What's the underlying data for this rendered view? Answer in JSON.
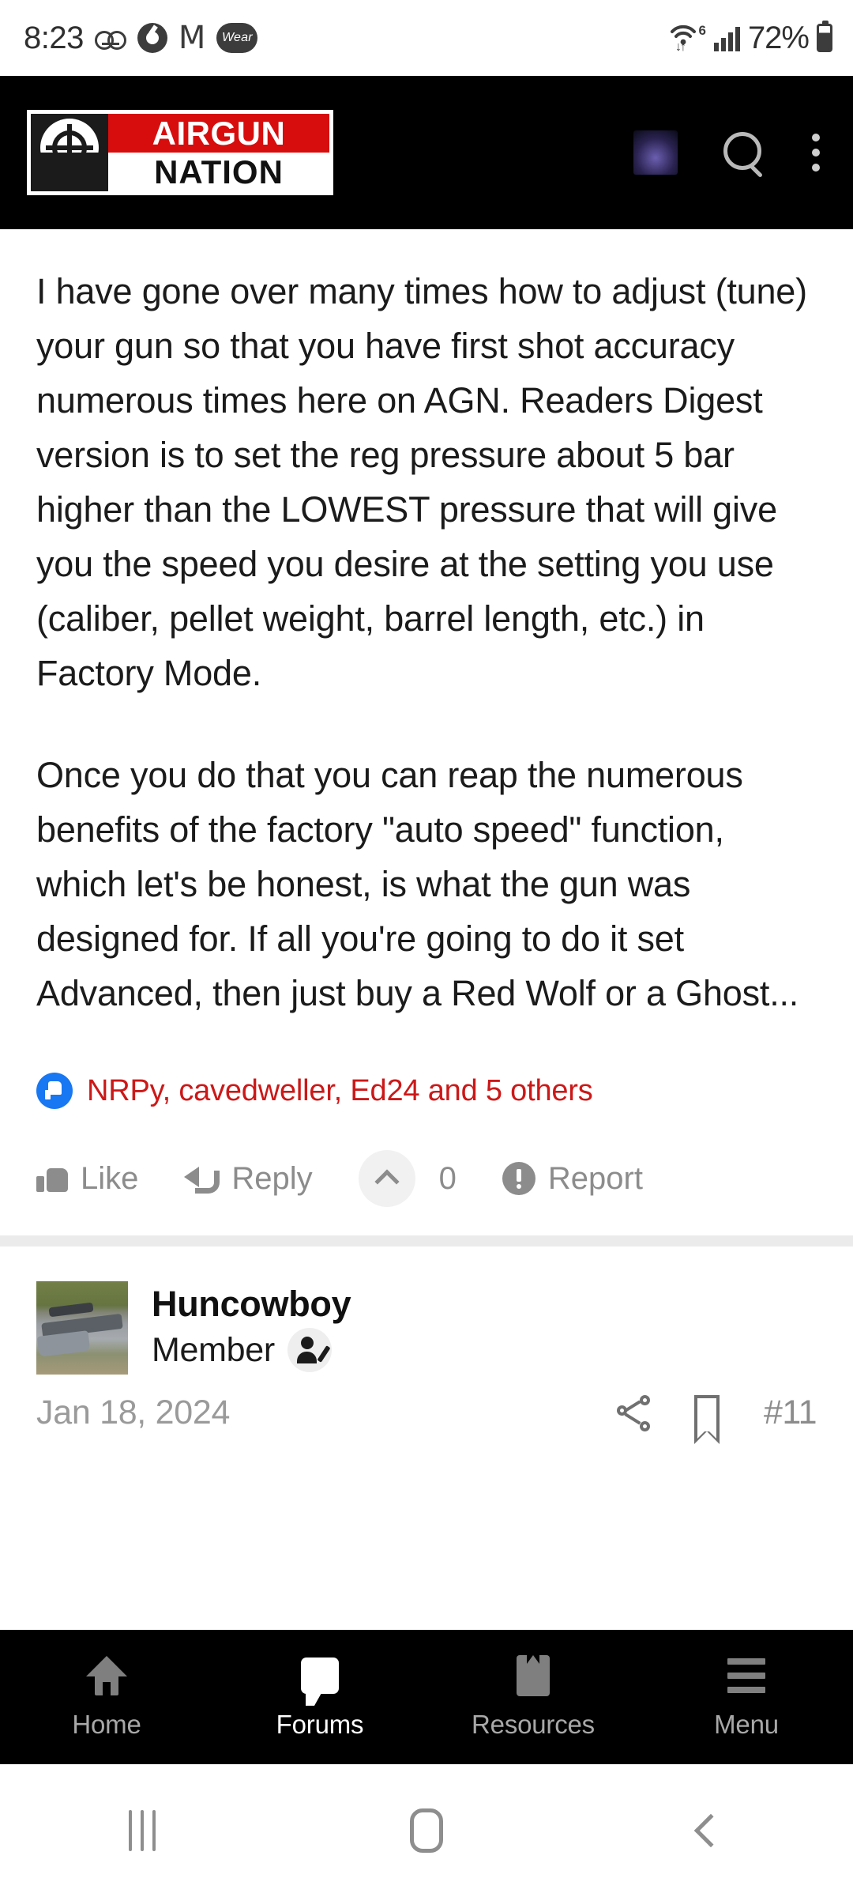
{
  "statusbar": {
    "time": "8:23",
    "battery_percent": "72%",
    "wifi_gen": "6",
    "icons": [
      "voicemail-icon",
      "chrome-icon",
      "gmail-icon",
      "wear-icon",
      "wifi-icon",
      "signal-icon",
      "battery-icon"
    ],
    "wear_label": "Wear"
  },
  "appbar": {
    "logo_top": "AIRGUN",
    "logo_bottom": "NATION",
    "logo_mark": "crosshair-reticle-icon",
    "search_icon": "search-icon",
    "kebab_icon": "more-options-icon",
    "avatar_icon": "user-avatar-icon",
    "brand_red": "#d70d0d",
    "background": "#000000"
  },
  "post": {
    "paragraphs": [
      "I have gone over many times how to adjust (tune) your gun so that you have first shot accuracy numerous times here on AGN. Readers Digest version is to set the reg pressure about 5 bar higher than the LOWEST pressure that will give you the speed you desire at the setting you use (caliber, pellet weight, barrel length, etc.) in Factory Mode.",
      "Once you do that you can reap the numerous benefits of the factory \"auto speed\" function, which let's be honest, is what the gun was designed for. If all you're going to do it set Advanced, then just buy a Red Wolf or a Ghost..."
    ],
    "likes_text": "NRPy, cavedweller, Ed24 and 5 others",
    "likes_color": "#cc1818",
    "like_badge_color": "#1877f2",
    "actions": {
      "like": "Like",
      "reply": "Reply",
      "upvote_count": "0",
      "report": "Report"
    }
  },
  "next_post": {
    "username": "Huncowboy",
    "role": "Member",
    "role_badge": "member-edit-icon",
    "date": "Jan 18, 2024",
    "post_number": "#11",
    "share_icon": "share-icon",
    "bookmark_icon": "bookmark-icon",
    "avatar_icon": "user-avatar-rifle-photo"
  },
  "bottom_nav": {
    "items": [
      {
        "label": "Home",
        "icon": "home-icon",
        "active": false
      },
      {
        "label": "Forums",
        "icon": "speech-bubble-icon",
        "active": true
      },
      {
        "label": "Resources",
        "icon": "book-icon",
        "active": false
      },
      {
        "label": "Menu",
        "icon": "hamburger-menu-icon",
        "active": false
      }
    ]
  },
  "android_nav": {
    "recents": "recents-icon",
    "home": "android-home-icon",
    "back": "back-icon"
  }
}
